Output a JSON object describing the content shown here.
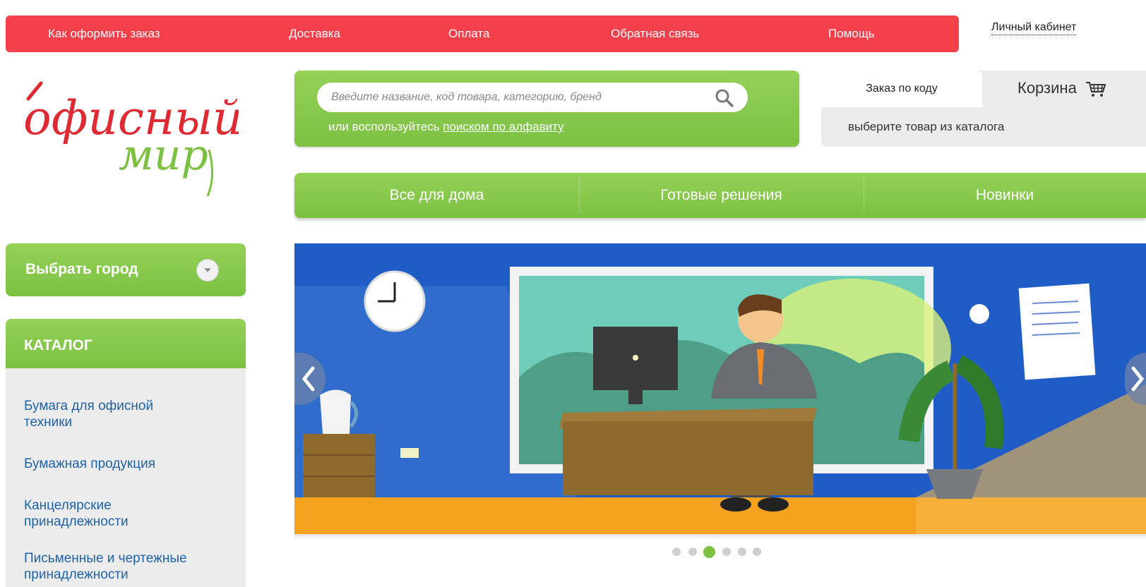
{
  "topnav": {
    "items": [
      "Как оформить заказ",
      "Доставка",
      "Оплата",
      "Обратная связь",
      "Помощь"
    ],
    "account": "Личный кабинет",
    "color": "#f53f4b"
  },
  "logo": {
    "line1": "офисный",
    "line2": "мир"
  },
  "search": {
    "placeholder": "Введите название, код товара, категорию, бренд",
    "alt_prefix": "или воспользуйтесь ",
    "alt_link": "поиском по алфавиту"
  },
  "order": {
    "tab_label": "Заказ по коду",
    "cart_label": "Корзина",
    "hint": "выберите товар из каталога"
  },
  "menu": {
    "items": [
      "Все для дома",
      "Готовые решения",
      "Новинки"
    ]
  },
  "sidebar": {
    "city_label": "Выбрать город",
    "catalog_title": "КАТАЛОГ",
    "catalog_items": [
      "Бумага для офисной техники",
      "Бумажная продукция",
      "Канцелярские принадлежности",
      "Письменные и чертежные принадлежности"
    ]
  },
  "slider": {
    "slide_count": 6,
    "active_index": 2
  },
  "colors": {
    "accent_green": "#7cc142",
    "brand_red": "#f53f4b",
    "link_blue": "#1f62a7"
  },
  "icons": [
    "search-icon",
    "cart-icon",
    "chevron-down-icon",
    "chevron-left-icon",
    "chevron-right-icon"
  ]
}
